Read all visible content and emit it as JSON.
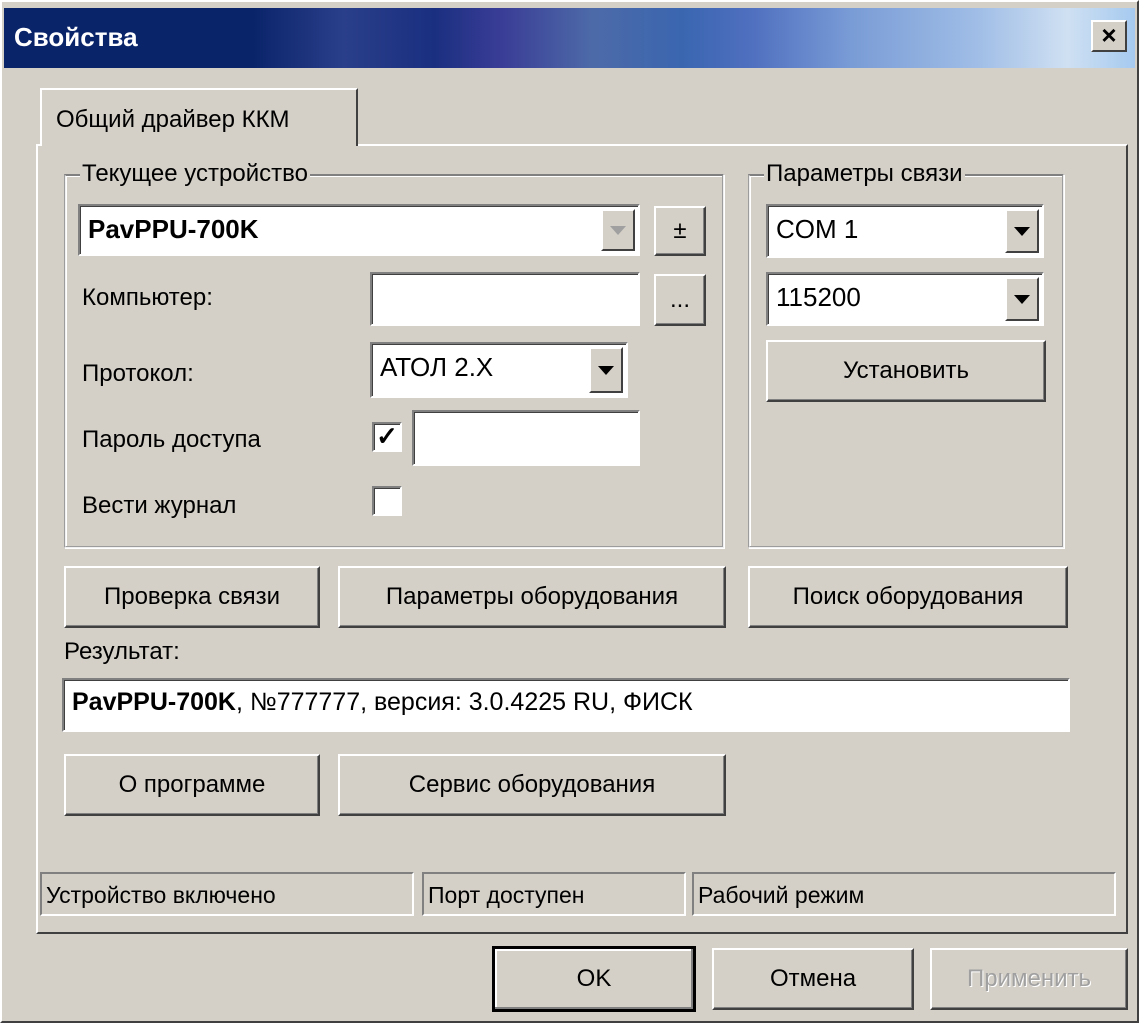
{
  "window": {
    "title": "Свойства",
    "close_glyph": "×"
  },
  "tab": {
    "label": "Общий драйвер ККМ"
  },
  "current_device": {
    "legend": "Текущее устройство",
    "device_value": "PavPPU-700K",
    "plusminus_label": "±",
    "computer_label": "Компьютер:",
    "computer_value": "",
    "browse_label": "...",
    "protocol_label": "Протокол:",
    "protocol_value": "АТОЛ 2.X",
    "password_label": "Пароль доступа",
    "password_checked": "✓",
    "password_value": "",
    "log_label": "Вести журнал",
    "log_checked": ""
  },
  "connection": {
    "legend": "Параметры связи",
    "port_value": "COM 1",
    "baud_value": "115200",
    "set_button": "Установить"
  },
  "buttons": {
    "check_connection": "Проверка связи",
    "equipment_params": "Параметры оборудования",
    "search_equipment": "Поиск оборудования",
    "about": "О программе",
    "equipment_service": "Сервис оборудования",
    "ok": "OK",
    "cancel": "Отмена",
    "apply": "Применить"
  },
  "result": {
    "label": "Результат:",
    "device": "PavPPU-700K",
    "details": ", №777777, версия: 3.0.4225 RU, ФИСК"
  },
  "status": {
    "device_on": "Устройство включено",
    "port_available": "Порт доступен",
    "work_mode": "Рабочий режим"
  },
  "colors": {
    "face": "#d4d0c8",
    "title_active": "#0a246a"
  }
}
